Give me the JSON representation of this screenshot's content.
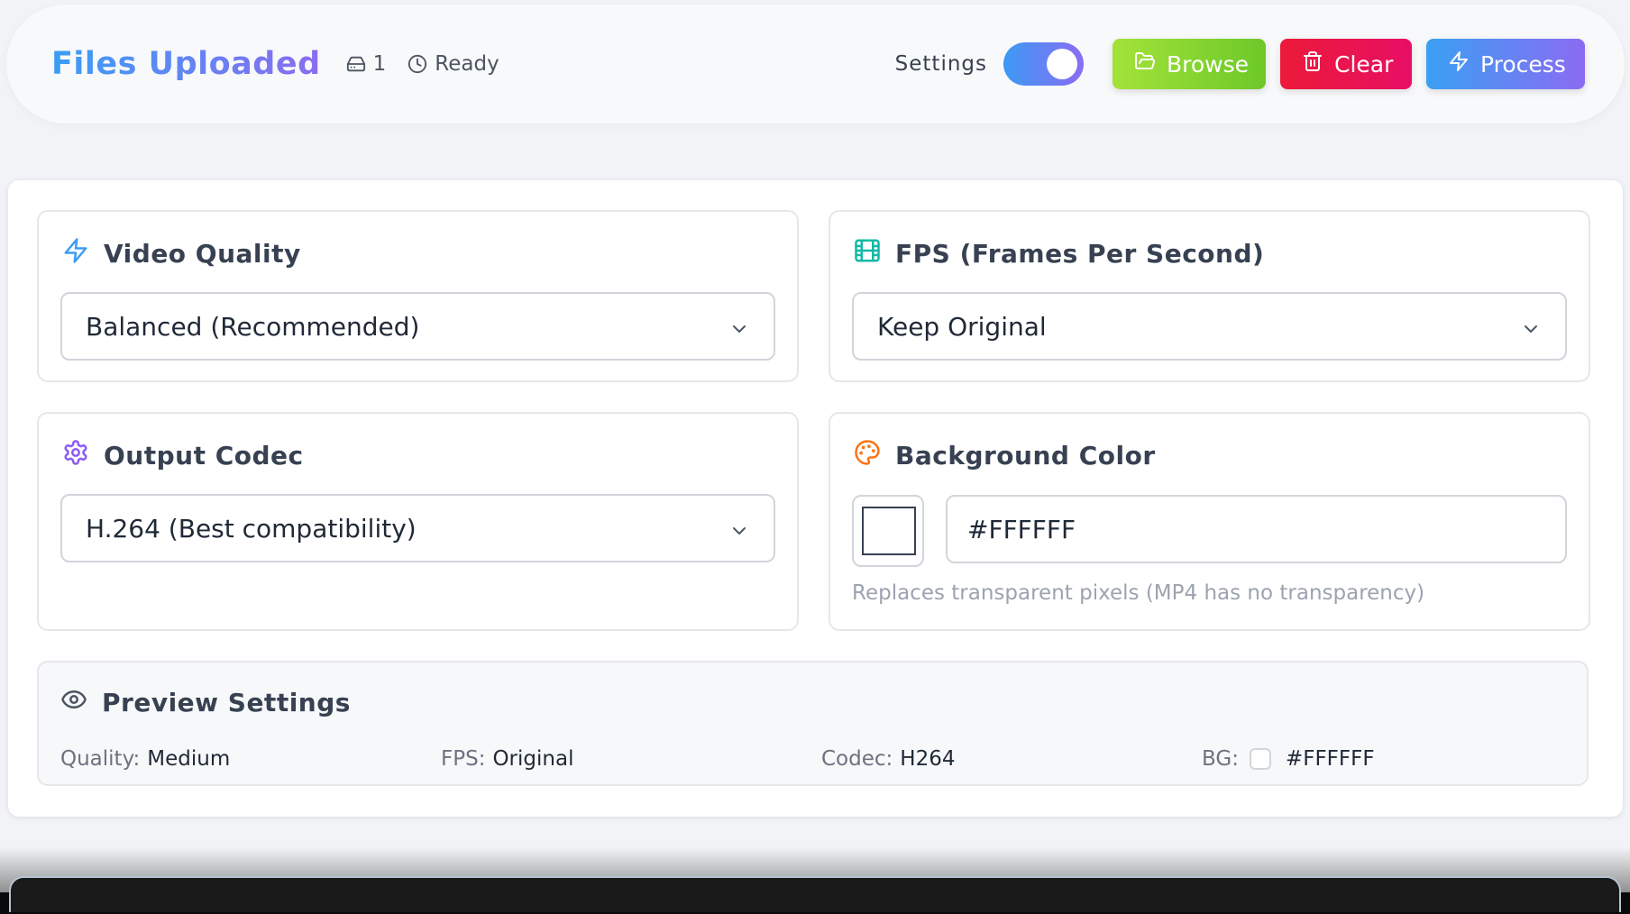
{
  "header": {
    "title": "Files Uploaded",
    "file_count": "1",
    "status": "Ready",
    "settings_label": "Settings",
    "settings_toggle_on": true,
    "buttons": {
      "browse": "Browse",
      "clear": "Clear",
      "process": "Process"
    }
  },
  "cards": {
    "video_quality": {
      "title": "Video Quality",
      "selected": "Balanced (Recommended)"
    },
    "fps": {
      "title": "FPS (Frames Per Second)",
      "selected": "Keep Original"
    },
    "codec": {
      "title": "Output Codec",
      "selected": "H.264 (Best compatibility)"
    },
    "background": {
      "title": "Background Color",
      "value": "#FFFFFF",
      "hint": "Replaces transparent pixels (MP4 has no transparency)"
    }
  },
  "preview": {
    "title": "Preview Settings",
    "quality_label": "Quality:",
    "quality_value": "Medium",
    "fps_label": "FPS:",
    "fps_value": "Original",
    "codec_label": "Codec:",
    "codec_value": "H264",
    "bg_label": "BG:",
    "bg_value": "#FFFFFF"
  },
  "colors": {
    "accent_gradient_start": "#3b9df4",
    "accent_gradient_end": "#8a6cf2",
    "browse": "#8bd630",
    "clear": "#e9164c",
    "icon_quality": "#3b9df4",
    "icon_fps": "#14b8a6",
    "icon_codec": "#8b5cf6",
    "icon_palette": "#f97316"
  },
  "icons": {
    "file_count": "hard-drive-icon",
    "status": "clock-icon",
    "browse": "folder-open-icon",
    "clear": "trash-icon",
    "process": "zap-icon",
    "quality": "zap-icon",
    "fps": "film-icon",
    "codec": "gear-icon",
    "background": "palette-icon",
    "preview": "eye-icon"
  }
}
